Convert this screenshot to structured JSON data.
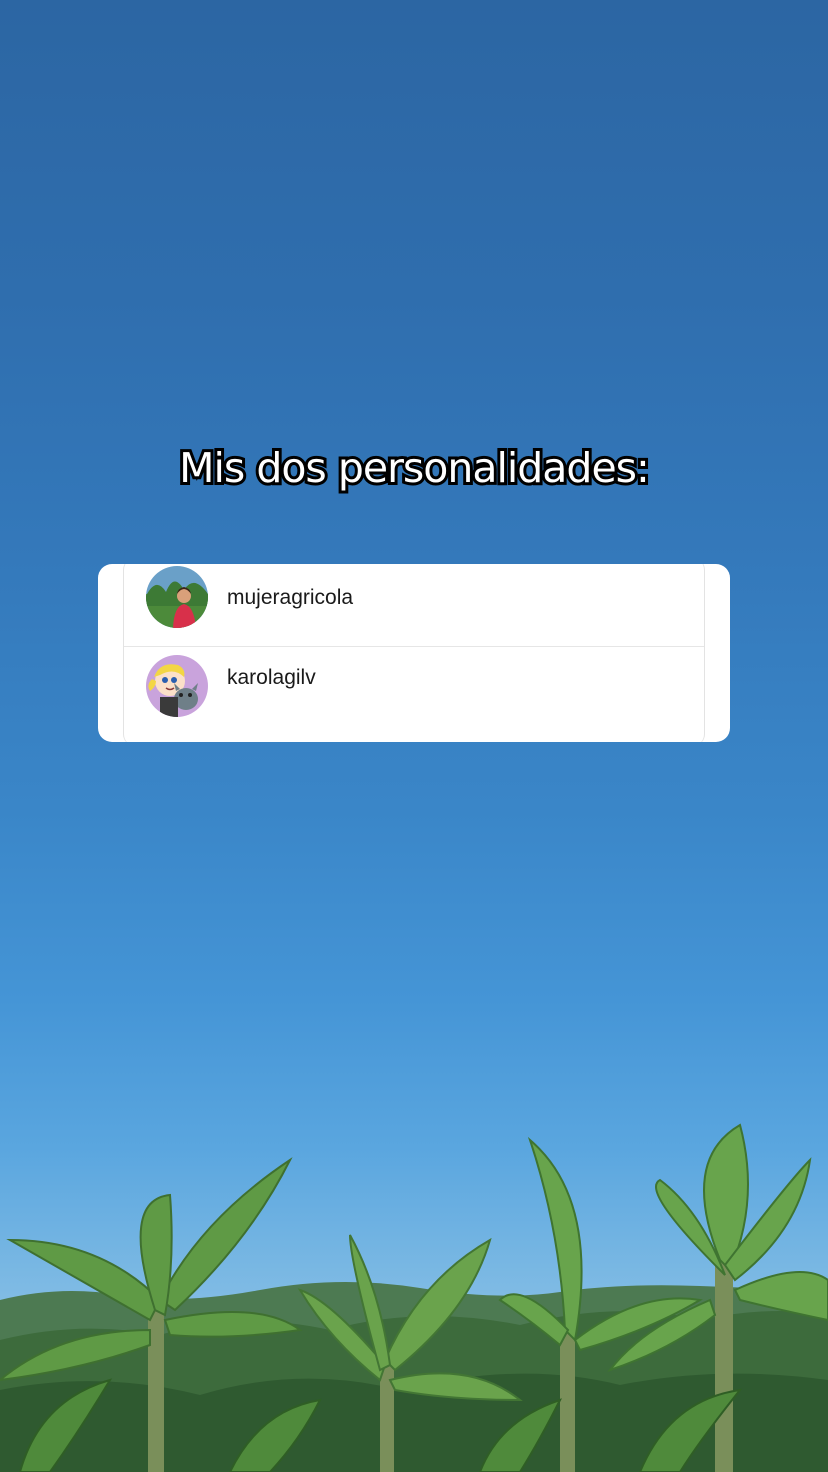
{
  "caption": "Mis dos personalidades:",
  "accounts": [
    {
      "username": "mujeragricola",
      "avatar": "farm-woman-photo"
    },
    {
      "username": "karolagilv",
      "avatar": "cartoon-girl-with-dog"
    }
  ],
  "background": {
    "sky_top": "#2c66a3",
    "sky_bottom": "#9ccbe8",
    "plants": "banana-plantation"
  }
}
